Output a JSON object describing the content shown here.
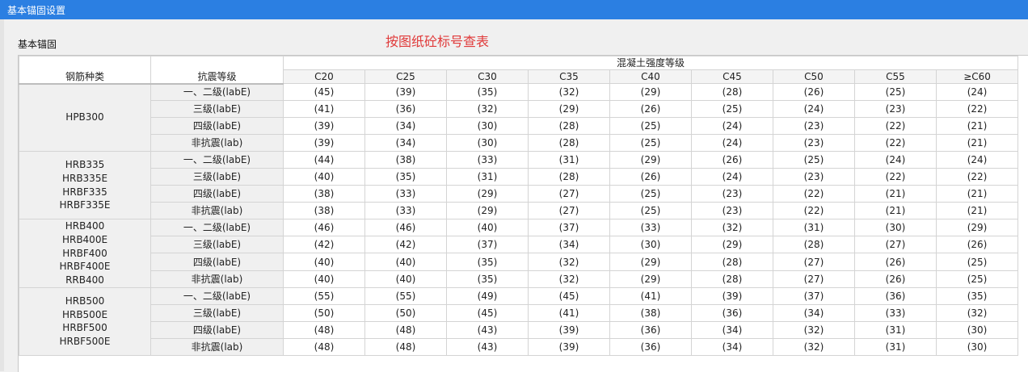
{
  "window": {
    "title": "基本锚固设置"
  },
  "section_label": "基本锚固",
  "note": "按图纸砼标号查表",
  "table": {
    "col_steel": "钢筋种类",
    "col_seismic": "抗震等级",
    "concrete_group": "混凝土强度等级",
    "grades": [
      "C20",
      "C25",
      "C30",
      "C35",
      "C40",
      "C45",
      "C50",
      "C55",
      "≥C60"
    ],
    "groups": [
      {
        "steels": [
          "HPB300"
        ],
        "rows": [
          {
            "level": "一、二级(labE)",
            "values": [
              "(45)",
              "(39)",
              "(35)",
              "(32)",
              "(29)",
              "(28)",
              "(26)",
              "(25)",
              "(24)"
            ]
          },
          {
            "level": "三级(labE)",
            "values": [
              "(41)",
              "(36)",
              "(32)",
              "(29)",
              "(26)",
              "(25)",
              "(24)",
              "(23)",
              "(22)"
            ]
          },
          {
            "level": "四级(labE)",
            "values": [
              "(39)",
              "(34)",
              "(30)",
              "(28)",
              "(25)",
              "(24)",
              "(23)",
              "(22)",
              "(21)"
            ]
          },
          {
            "level": "非抗震(lab)",
            "values": [
              "(39)",
              "(34)",
              "(30)",
              "(28)",
              "(25)",
              "(24)",
              "(23)",
              "(22)",
              "(21)"
            ]
          }
        ]
      },
      {
        "steels": [
          "HRB335",
          "HRB335E",
          "HRBF335",
          "HRBF335E"
        ],
        "rows": [
          {
            "level": "一、二级(labE)",
            "values": [
              "(44)",
              "(38)",
              "(33)",
              "(31)",
              "(29)",
              "(26)",
              "(25)",
              "(24)",
              "(24)"
            ]
          },
          {
            "level": "三级(labE)",
            "values": [
              "(40)",
              "(35)",
              "(31)",
              "(28)",
              "(26)",
              "(24)",
              "(23)",
              "(22)",
              "(22)"
            ]
          },
          {
            "level": "四级(labE)",
            "values": [
              "(38)",
              "(33)",
              "(29)",
              "(27)",
              "(25)",
              "(23)",
              "(22)",
              "(21)",
              "(21)"
            ]
          },
          {
            "level": "非抗震(lab)",
            "values": [
              "(38)",
              "(33)",
              "(29)",
              "(27)",
              "(25)",
              "(23)",
              "(22)",
              "(21)",
              "(21)"
            ]
          }
        ]
      },
      {
        "steels": [
          "HRB400",
          "HRB400E",
          "HRBF400",
          "HRBF400E",
          "RRB400"
        ],
        "rows": [
          {
            "level": "一、二级(labE)",
            "values": [
              "(46)",
              "(46)",
              "(40)",
              "(37)",
              "(33)",
              "(32)",
              "(31)",
              "(30)",
              "(29)"
            ]
          },
          {
            "level": "三级(labE)",
            "values": [
              "(42)",
              "(42)",
              "(37)",
              "(34)",
              "(30)",
              "(29)",
              "(28)",
              "(27)",
              "(26)"
            ]
          },
          {
            "level": "四级(labE)",
            "values": [
              "(40)",
              "(40)",
              "(35)",
              "(32)",
              "(29)",
              "(28)",
              "(27)",
              "(26)",
              "(25)"
            ]
          },
          {
            "level": "非抗震(lab)",
            "values": [
              "(40)",
              "(40)",
              "(35)",
              "(32)",
              "(29)",
              "(28)",
              "(27)",
              "(26)",
              "(25)"
            ]
          }
        ]
      },
      {
        "steels": [
          "HRB500",
          "HRB500E",
          "HRBF500",
          "HRBF500E"
        ],
        "rows": [
          {
            "level": "一、二级(labE)",
            "values": [
              "(55)",
              "(55)",
              "(49)",
              "(45)",
              "(41)",
              "(39)",
              "(37)",
              "(36)",
              "(35)"
            ]
          },
          {
            "level": "三级(labE)",
            "values": [
              "(50)",
              "(50)",
              "(45)",
              "(41)",
              "(38)",
              "(36)",
              "(34)",
              "(33)",
              "(32)"
            ]
          },
          {
            "level": "四级(labE)",
            "values": [
              "(48)",
              "(48)",
              "(43)",
              "(39)",
              "(36)",
              "(34)",
              "(32)",
              "(31)",
              "(30)"
            ]
          },
          {
            "level": "非抗震(lab)",
            "values": [
              "(48)",
              "(48)",
              "(43)",
              "(39)",
              "(36)",
              "(34)",
              "(32)",
              "(31)",
              "(30)"
            ]
          }
        ]
      }
    ]
  }
}
